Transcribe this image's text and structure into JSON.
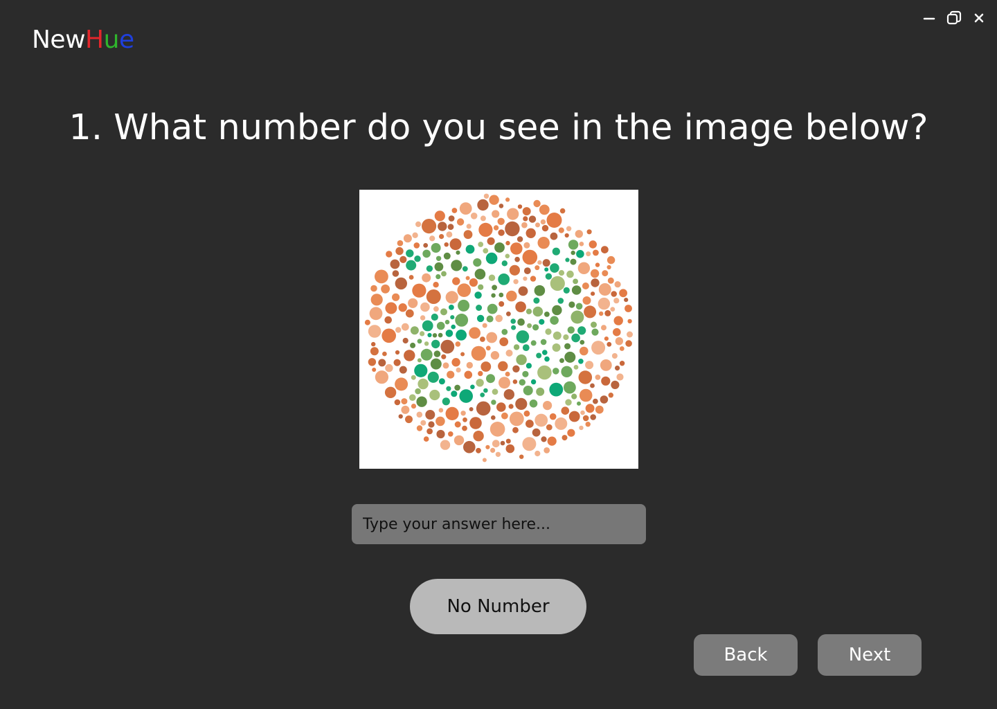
{
  "app": {
    "logo": {
      "parts": [
        {
          "text": "New",
          "color": "#ffffff"
        },
        {
          "text": "H",
          "color": "#e3262b"
        },
        {
          "text": "u",
          "color": "#2fb52c"
        },
        {
          "text": "e",
          "color": "#1f3fdc"
        }
      ]
    },
    "window_controls": {
      "icons": [
        "minimize-icon",
        "restore-icon",
        "close-icon"
      ]
    }
  },
  "question": {
    "text": "1. What number do you see in the image below?"
  },
  "plate": {
    "icon": "ishihara-color-plate",
    "colors": {
      "background_dots": [
        "#e98b55",
        "#d4723f",
        "#f0a77d",
        "#c9683b",
        "#e47b45",
        "#f2b38e",
        "#b8643e"
      ],
      "figure_dots": [
        "#1faa74",
        "#0ea877",
        "#6ea95d",
        "#8fb36a",
        "#a9c07b",
        "#5f8d44"
      ]
    }
  },
  "answer": {
    "value": "",
    "placeholder": "Type your answer here..."
  },
  "buttons": {
    "no_number": "No Number",
    "back": "Back",
    "next": "Next"
  }
}
